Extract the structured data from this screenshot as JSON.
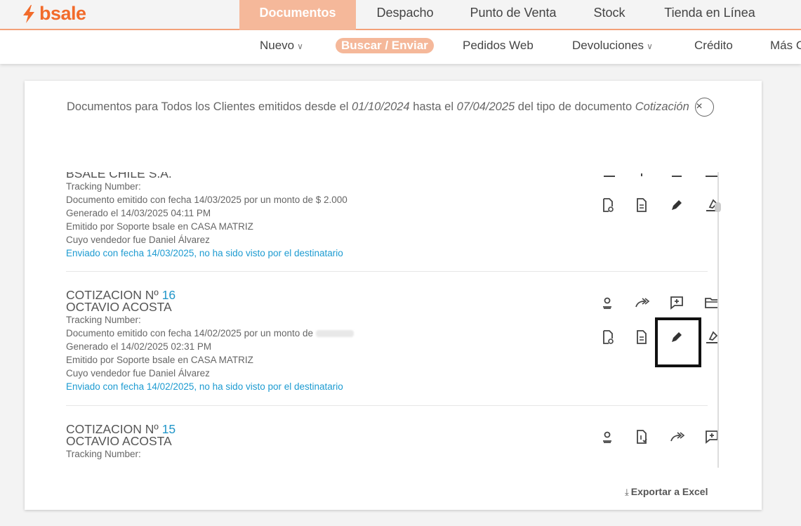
{
  "brand": {
    "name": "bsale",
    "color": "#f26b2b"
  },
  "main_tabs": [
    {
      "label": "Documentos",
      "active": true
    },
    {
      "label": "Despacho",
      "active": false
    },
    {
      "label": "Punto de Venta",
      "active": false
    },
    {
      "label": "Stock",
      "active": false
    },
    {
      "label": "Tienda en Línea",
      "active": false
    }
  ],
  "sub_nav": [
    {
      "label": "Nuevo",
      "dropdown": true
    },
    {
      "label": "Buscar / Enviar",
      "active": true
    },
    {
      "label": "Pedidos Web"
    },
    {
      "label": "Devoluciones",
      "dropdown": true
    },
    {
      "label": "Crédito"
    },
    {
      "label": "Más C"
    }
  ],
  "filter": {
    "prefix": "Documentos para Todos los Clientes emitidos desde el",
    "date_from": "01/10/2024",
    "mid": "hasta el",
    "date_to": "07/04/2025",
    "suffix": "del tipo de documento",
    "doc_type": "Cotización",
    "clear_icon": "×"
  },
  "documents": [
    {
      "client": "BSALE CHILE S.A.",
      "tracking": "Tracking Number:",
      "emitted": "Documento emitido con fecha 14/03/2025 por un monto de $ 2.000",
      "generated": "Generado el 14/03/2025 04:11 PM",
      "issued_by": "Emitido por Soporte bsale en CASA MATRIZ",
      "seller": "Cuyo vendedor fue Daniel Álvarez",
      "sent": "Enviado con fecha 14/03/2025, no ha sido visto por el destinatario"
    },
    {
      "title_prefix": "COTIZACION Nº",
      "number": "16",
      "client": "OCTAVIO ACOSTA",
      "tracking": "Tracking Number:",
      "emitted": "Documento emitido con fecha 14/02/2025 por un monto de",
      "generated": "Generado el 14/02/2025 02:31 PM",
      "issued_by": "Emitido por Soporte bsale en CASA MATRIZ",
      "seller": "Cuyo vendedor fue Daniel Álvarez",
      "sent": "Enviado con fecha 14/02/2025, no ha sido visto por el destinatario"
    },
    {
      "title_prefix": "COTIZACION Nº",
      "number": "15",
      "client": "OCTAVIO ACOSTA",
      "tracking": "Tracking Number:"
    }
  ],
  "export": {
    "label": "Exportar a Excel",
    "icon": "⤓"
  }
}
